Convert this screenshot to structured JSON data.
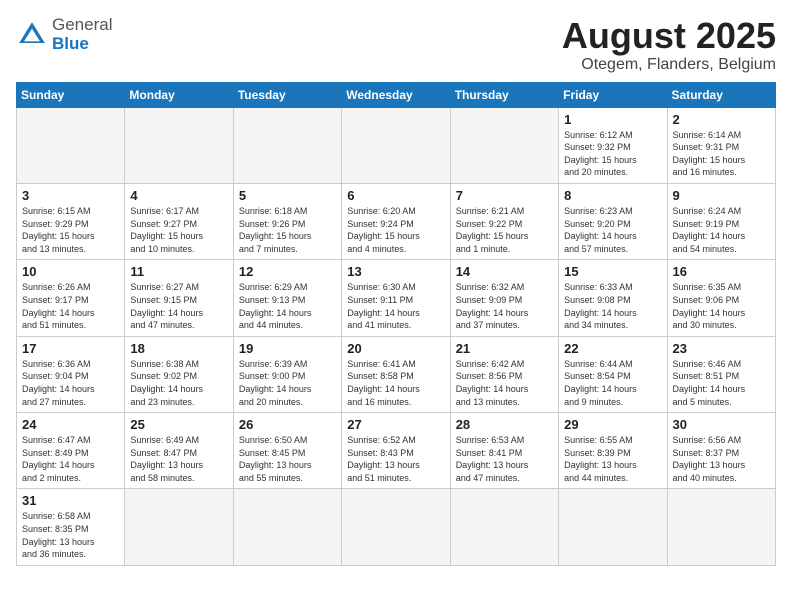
{
  "header": {
    "logo_general": "General",
    "logo_blue": "Blue",
    "month_title": "August 2025",
    "subtitle": "Otegem, Flanders, Belgium"
  },
  "weekdays": [
    "Sunday",
    "Monday",
    "Tuesday",
    "Wednesday",
    "Thursday",
    "Friday",
    "Saturday"
  ],
  "weeks": [
    [
      {
        "day": "",
        "info": ""
      },
      {
        "day": "",
        "info": ""
      },
      {
        "day": "",
        "info": ""
      },
      {
        "day": "",
        "info": ""
      },
      {
        "day": "",
        "info": ""
      },
      {
        "day": "1",
        "info": "Sunrise: 6:12 AM\nSunset: 9:32 PM\nDaylight: 15 hours\nand 20 minutes."
      },
      {
        "day": "2",
        "info": "Sunrise: 6:14 AM\nSunset: 9:31 PM\nDaylight: 15 hours\nand 16 minutes."
      }
    ],
    [
      {
        "day": "3",
        "info": "Sunrise: 6:15 AM\nSunset: 9:29 PM\nDaylight: 15 hours\nand 13 minutes."
      },
      {
        "day": "4",
        "info": "Sunrise: 6:17 AM\nSunset: 9:27 PM\nDaylight: 15 hours\nand 10 minutes."
      },
      {
        "day": "5",
        "info": "Sunrise: 6:18 AM\nSunset: 9:26 PM\nDaylight: 15 hours\nand 7 minutes."
      },
      {
        "day": "6",
        "info": "Sunrise: 6:20 AM\nSunset: 9:24 PM\nDaylight: 15 hours\nand 4 minutes."
      },
      {
        "day": "7",
        "info": "Sunrise: 6:21 AM\nSunset: 9:22 PM\nDaylight: 15 hours\nand 1 minute."
      },
      {
        "day": "8",
        "info": "Sunrise: 6:23 AM\nSunset: 9:20 PM\nDaylight: 14 hours\nand 57 minutes."
      },
      {
        "day": "9",
        "info": "Sunrise: 6:24 AM\nSunset: 9:19 PM\nDaylight: 14 hours\nand 54 minutes."
      }
    ],
    [
      {
        "day": "10",
        "info": "Sunrise: 6:26 AM\nSunset: 9:17 PM\nDaylight: 14 hours\nand 51 minutes."
      },
      {
        "day": "11",
        "info": "Sunrise: 6:27 AM\nSunset: 9:15 PM\nDaylight: 14 hours\nand 47 minutes."
      },
      {
        "day": "12",
        "info": "Sunrise: 6:29 AM\nSunset: 9:13 PM\nDaylight: 14 hours\nand 44 minutes."
      },
      {
        "day": "13",
        "info": "Sunrise: 6:30 AM\nSunset: 9:11 PM\nDaylight: 14 hours\nand 41 minutes."
      },
      {
        "day": "14",
        "info": "Sunrise: 6:32 AM\nSunset: 9:09 PM\nDaylight: 14 hours\nand 37 minutes."
      },
      {
        "day": "15",
        "info": "Sunrise: 6:33 AM\nSunset: 9:08 PM\nDaylight: 14 hours\nand 34 minutes."
      },
      {
        "day": "16",
        "info": "Sunrise: 6:35 AM\nSunset: 9:06 PM\nDaylight: 14 hours\nand 30 minutes."
      }
    ],
    [
      {
        "day": "17",
        "info": "Sunrise: 6:36 AM\nSunset: 9:04 PM\nDaylight: 14 hours\nand 27 minutes."
      },
      {
        "day": "18",
        "info": "Sunrise: 6:38 AM\nSunset: 9:02 PM\nDaylight: 14 hours\nand 23 minutes."
      },
      {
        "day": "19",
        "info": "Sunrise: 6:39 AM\nSunset: 9:00 PM\nDaylight: 14 hours\nand 20 minutes."
      },
      {
        "day": "20",
        "info": "Sunrise: 6:41 AM\nSunset: 8:58 PM\nDaylight: 14 hours\nand 16 minutes."
      },
      {
        "day": "21",
        "info": "Sunrise: 6:42 AM\nSunset: 8:56 PM\nDaylight: 14 hours\nand 13 minutes."
      },
      {
        "day": "22",
        "info": "Sunrise: 6:44 AM\nSunset: 8:54 PM\nDaylight: 14 hours\nand 9 minutes."
      },
      {
        "day": "23",
        "info": "Sunrise: 6:46 AM\nSunset: 8:51 PM\nDaylight: 14 hours\nand 5 minutes."
      }
    ],
    [
      {
        "day": "24",
        "info": "Sunrise: 6:47 AM\nSunset: 8:49 PM\nDaylight: 14 hours\nand 2 minutes."
      },
      {
        "day": "25",
        "info": "Sunrise: 6:49 AM\nSunset: 8:47 PM\nDaylight: 13 hours\nand 58 minutes."
      },
      {
        "day": "26",
        "info": "Sunrise: 6:50 AM\nSunset: 8:45 PM\nDaylight: 13 hours\nand 55 minutes."
      },
      {
        "day": "27",
        "info": "Sunrise: 6:52 AM\nSunset: 8:43 PM\nDaylight: 13 hours\nand 51 minutes."
      },
      {
        "day": "28",
        "info": "Sunrise: 6:53 AM\nSunset: 8:41 PM\nDaylight: 13 hours\nand 47 minutes."
      },
      {
        "day": "29",
        "info": "Sunrise: 6:55 AM\nSunset: 8:39 PM\nDaylight: 13 hours\nand 44 minutes."
      },
      {
        "day": "30",
        "info": "Sunrise: 6:56 AM\nSunset: 8:37 PM\nDaylight: 13 hours\nand 40 minutes."
      }
    ],
    [
      {
        "day": "31",
        "info": "Sunrise: 6:58 AM\nSunset: 8:35 PM\nDaylight: 13 hours\nand 36 minutes."
      },
      {
        "day": "",
        "info": ""
      },
      {
        "day": "",
        "info": ""
      },
      {
        "day": "",
        "info": ""
      },
      {
        "day": "",
        "info": ""
      },
      {
        "day": "",
        "info": ""
      },
      {
        "day": "",
        "info": ""
      }
    ]
  ]
}
